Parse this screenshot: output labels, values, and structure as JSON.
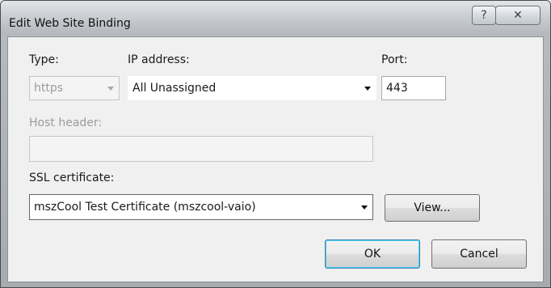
{
  "window": {
    "title": "Edit Web Site Binding",
    "help_glyph": "?",
    "close_glyph": "✕"
  },
  "type": {
    "label": "Type:",
    "value": "https"
  },
  "ip_address": {
    "label": "IP address:",
    "value": "All Unassigned"
  },
  "port": {
    "label": "Port:",
    "value": "443"
  },
  "host_header": {
    "label": "Host header:",
    "value": ""
  },
  "ssl_certificate": {
    "label": "SSL certificate:",
    "value": "mszCool Test Certificate (mszcool-vaio)"
  },
  "buttons": {
    "view": "View...",
    "ok": "OK",
    "cancel": "Cancel"
  }
}
